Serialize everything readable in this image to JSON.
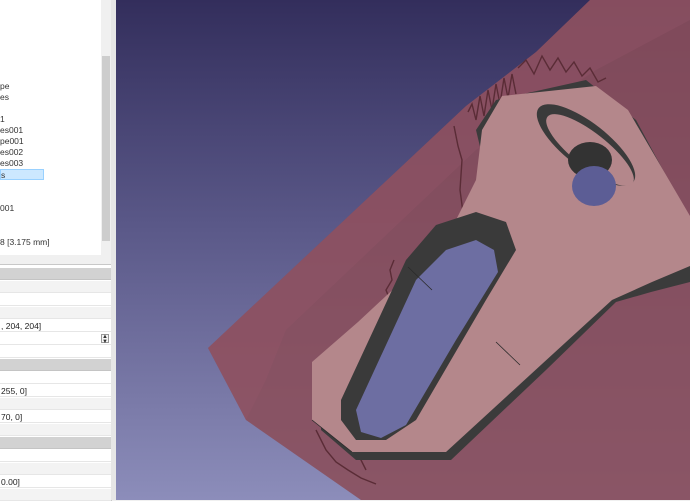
{
  "tree": {
    "items": [
      {
        "label": "pe"
      },
      {
        "label": "es"
      },
      {
        "label": "1"
      },
      {
        "label": "es001"
      },
      {
        "label": "pe001"
      },
      {
        "label": "es002"
      },
      {
        "label": "es003"
      },
      {
        "label": "s",
        "selected": true
      },
      {
        "label": "001"
      },
      {
        "label": "8 [3.175 mm]"
      }
    ]
  },
  "properties": {
    "rows": [
      {
        "value": "",
        "kind": "group"
      },
      {
        "value": "",
        "kind": "alt"
      },
      {
        "value": "",
        "kind": "normal"
      },
      {
        "value": "",
        "kind": "alt"
      },
      {
        "value": ", 204, 204]",
        "kind": "normal"
      },
      {
        "value": "",
        "kind": "spin"
      },
      {
        "value": "",
        "kind": "normal"
      },
      {
        "value": "",
        "kind": "group"
      },
      {
        "value": "",
        "kind": "normal"
      },
      {
        "value": "255, 0]",
        "kind": "normal"
      },
      {
        "value": "",
        "kind": "alt"
      },
      {
        "value": "70, 0]",
        "kind": "normal"
      },
      {
        "value": "",
        "kind": "alt"
      },
      {
        "value": "",
        "kind": "group"
      },
      {
        "value": "",
        "kind": "normal"
      },
      {
        "value": "",
        "kind": "alt"
      },
      {
        "value": "0.00]",
        "kind": "normal"
      },
      {
        "value": "",
        "kind": "alt"
      }
    ],
    "spin_up": "▲",
    "spin_down": "▼"
  },
  "colors": {
    "background_top": "#332e5c",
    "background_bottom": "#8c8dba",
    "stock": "#8a4d5a",
    "part_face": "#b4878b",
    "wall": "#3a3a3a"
  }
}
